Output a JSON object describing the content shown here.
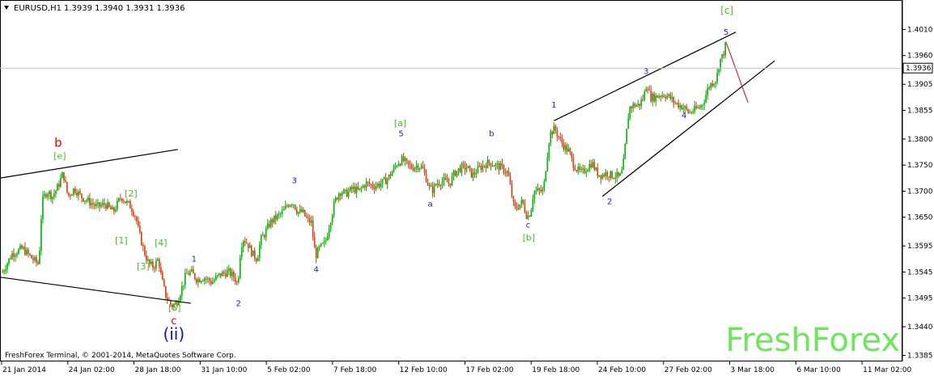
{
  "window": {
    "symbol_label": "EURUSD,H1",
    "ohlc_label": "1.3939 1.3940 1.3931 1.3936",
    "copyright": "FreshForex Terminal, © 2001-2014, MetaQuotes Software Corp.",
    "brand": "FreshForex",
    "menu_icon": "triangle-down-icon"
  },
  "colors": {
    "bull_candle": "#00b000",
    "bear_candle": "#d04010",
    "green_label": "#40c020",
    "blue_label": "#1a1acc",
    "red_label": "#e00000",
    "navy_label": "#0a1a9a",
    "projection": "#c03050",
    "trendline": "#000000",
    "price_tag_bg": "#ffffff"
  },
  "chart_data": {
    "type": "candlestick",
    "symbol": "EURUSD",
    "timeframe": "H1",
    "y_ticks": [
      "1.4010",
      "1.3960",
      "1.3905",
      "1.3855",
      "1.3800",
      "1.3750",
      "1.3700",
      "1.3650",
      "1.3595",
      "1.3545",
      "1.3495",
      "1.3440",
      "1.3385"
    ],
    "ylim": [
      1.3375,
      1.4065
    ],
    "current_price": "1.3936",
    "current_price_value": 1.3936,
    "x_ticks": [
      "21 Jan 2014",
      "24 Jan 02:00",
      "28 Jan 18:00",
      "31 Jan 10:00",
      "5 Feb 02:00",
      "7 Feb 18:00",
      "12 Feb 10:00",
      "17 Feb 02:00",
      "19 Feb 18:00",
      "24 Feb 10:00",
      "27 Feb 02:00",
      "3 Mar 18:00",
      "6 Mar 10:00",
      "11 Mar 02:00"
    ],
    "x_range": [
      0,
      1115
    ],
    "price_path": [
      [
        3,
        1.3545
      ],
      [
        15,
        1.358
      ],
      [
        28,
        1.359
      ],
      [
        40,
        1.357
      ],
      [
        48,
        1.356
      ],
      [
        52,
        1.368
      ],
      [
        58,
        1.37
      ],
      [
        65,
        1.369
      ],
      [
        72,
        1.371
      ],
      [
        78,
        1.3735
      ],
      [
        84,
        1.369
      ],
      [
        92,
        1.3705
      ],
      [
        100,
        1.369
      ],
      [
        110,
        1.368
      ],
      [
        120,
        1.367
      ],
      [
        130,
        1.3675
      ],
      [
        140,
        1.366
      ],
      [
        150,
        1.369
      ],
      [
        155,
        1.368
      ],
      [
        162,
        1.367
      ],
      [
        168,
        1.365
      ],
      [
        172,
        1.362
      ],
      [
        178,
        1.3585
      ],
      [
        184,
        1.356
      ],
      [
        190,
        1.3555
      ],
      [
        196,
        1.357
      ],
      [
        200,
        1.353
      ],
      [
        205,
        1.35
      ],
      [
        212,
        1.348
      ],
      [
        218,
        1.3485
      ],
      [
        224,
        1.351
      ],
      [
        230,
        1.354
      ],
      [
        236,
        1.3545
      ],
      [
        244,
        1.353
      ],
      [
        252,
        1.3535
      ],
      [
        262,
        1.3525
      ],
      [
        272,
        1.354
      ],
      [
        282,
        1.3545
      ],
      [
        290,
        1.3535
      ],
      [
        294,
        1.352
      ],
      [
        297,
        1.358
      ],
      [
        300,
        1.361
      ],
      [
        306,
        1.36
      ],
      [
        312,
        1.358
      ],
      [
        318,
        1.357
      ],
      [
        322,
        1.3605
      ],
      [
        328,
        1.362
      ],
      [
        334,
        1.364
      ],
      [
        342,
        1.365
      ],
      [
        350,
        1.366
      ],
      [
        356,
        1.3675
      ],
      [
        362,
        1.368
      ],
      [
        368,
        1.366
      ],
      [
        374,
        1.366
      ],
      [
        380,
        1.3645
      ],
      [
        385,
        1.364
      ],
      [
        390,
        1.3575
      ],
      [
        395,
        1.359
      ],
      [
        402,
        1.36
      ],
      [
        408,
        1.364
      ],
      [
        414,
        1.368
      ],
      [
        420,
        1.37
      ],
      [
        428,
        1.3695
      ],
      [
        436,
        1.3705
      ],
      [
        444,
        1.37
      ],
      [
        452,
        1.3715
      ],
      [
        462,
        1.371
      ],
      [
        472,
        1.3715
      ],
      [
        480,
        1.3725
      ],
      [
        486,
        1.374
      ],
      [
        492,
        1.3755
      ],
      [
        498,
        1.376
      ],
      [
        504,
        1.375
      ],
      [
        510,
        1.3745
      ],
      [
        516,
        1.375
      ],
      [
        522,
        1.3745
      ],
      [
        526,
        1.373
      ],
      [
        530,
        1.371
      ],
      [
        534,
        1.37
      ],
      [
        540,
        1.3715
      ],
      [
        548,
        1.372
      ],
      [
        556,
        1.3715
      ],
      [
        562,
        1.3735
      ],
      [
        570,
        1.3745
      ],
      [
        578,
        1.3745
      ],
      [
        584,
        1.373
      ],
      [
        590,
        1.374
      ],
      [
        598,
        1.375
      ],
      [
        606,
        1.3755
      ],
      [
        612,
        1.375
      ],
      [
        620,
        1.3745
      ],
      [
        628,
        1.3735
      ],
      [
        632,
        1.37
      ],
      [
        636,
        1.3665
      ],
      [
        640,
        1.367
      ],
      [
        646,
        1.368
      ],
      [
        652,
        1.365
      ],
      [
        656,
        1.366
      ],
      [
        660,
        1.37
      ],
      [
        666,
        1.37
      ],
      [
        672,
        1.37
      ],
      [
        676,
        1.376
      ],
      [
        680,
        1.381
      ],
      [
        686,
        1.382
      ],
      [
        692,
        1.38
      ],
      [
        698,
        1.3785
      ],
      [
        704,
        1.3775
      ],
      [
        708,
        1.3755
      ],
      [
        714,
        1.374
      ],
      [
        720,
        1.3735
      ],
      [
        726,
        1.3745
      ],
      [
        732,
        1.3755
      ],
      [
        738,
        1.3735
      ],
      [
        744,
        1.373
      ],
      [
        750,
        1.3735
      ],
      [
        756,
        1.373
      ],
      [
        762,
        1.373
      ],
      [
        766,
        1.3725
      ],
      [
        770,
        1.374
      ],
      [
        774,
        1.38
      ],
      [
        778,
        1.386
      ],
      [
        784,
        1.3865
      ],
      [
        790,
        1.3865
      ],
      [
        796,
        1.388
      ],
      [
        800,
        1.391
      ],
      [
        804,
        1.388
      ],
      [
        810,
        1.388
      ],
      [
        816,
        1.3885
      ],
      [
        822,
        1.3885
      ],
      [
        828,
        1.388
      ],
      [
        834,
        1.387
      ],
      [
        840,
        1.3865
      ],
      [
        846,
        1.386
      ],
      [
        852,
        1.385
      ],
      [
        858,
        1.3855
      ],
      [
        864,
        1.386
      ],
      [
        868,
        1.3865
      ],
      [
        872,
        1.388
      ],
      [
        876,
        1.39
      ],
      [
        882,
        1.391
      ],
      [
        886,
        1.3915
      ],
      [
        890,
        1.395
      ],
      [
        894,
        1.396
      ],
      [
        898,
        1.3985
      ]
    ],
    "trendlines": [
      {
        "x1": 0,
        "y1": 1.3725,
        "x2": 220,
        "y2": 1.378,
        "color": "#000000"
      },
      {
        "x1": 0,
        "y1": 1.3535,
        "x2": 236,
        "y2": 1.3485,
        "color": "#000000"
      },
      {
        "x1": 685,
        "y1": 1.3835,
        "x2": 910,
        "y2": 1.4005,
        "color": "#000000"
      },
      {
        "x1": 745,
        "y1": 1.369,
        "x2": 958,
        "y2": 1.395,
        "color": "#000000"
      },
      {
        "x1": 898,
        "y1": 1.3985,
        "x2": 925,
        "y2": 1.387,
        "color": "#c03050"
      }
    ],
    "annotations": [
      {
        "text": "b",
        "x": 72,
        "y": 1.3785,
        "color": "red",
        "size": 15
      },
      {
        "text": "[e]",
        "x": 74,
        "y": 1.3762,
        "color": "green",
        "size": 11
      },
      {
        "text": "[2]",
        "x": 162,
        "y": 1.369,
        "color": "green",
        "size": 11
      },
      {
        "text": "[1]",
        "x": 150,
        "y": 1.36,
        "color": "green",
        "size": 11
      },
      {
        "text": "[4]",
        "x": 199,
        "y": 1.3595,
        "color": "green",
        "size": 11
      },
      {
        "text": "[3]",
        "x": 177,
        "y": 1.355,
        "color": "green",
        "size": 11
      },
      {
        "text": "[5]",
        "x": 216,
        "y": 1.347,
        "color": "green",
        "size": 11
      },
      {
        "text": "c",
        "x": 215,
        "y": 1.3445,
        "color": "red",
        "size": 13
      },
      {
        "text": "(ii)",
        "x": 215,
        "y": 1.3415,
        "color": "navy",
        "size": 20
      },
      {
        "text": "1",
        "x": 240,
        "y": 1.3565,
        "color": "blue",
        "size": 10
      },
      {
        "text": "2",
        "x": 295,
        "y": 1.348,
        "color": "blue",
        "size": 10
      },
      {
        "text": "3",
        "x": 364,
        "y": 1.3715,
        "color": "blue",
        "size": 10
      },
      {
        "text": "4",
        "x": 391,
        "y": 1.3545,
        "color": "blue",
        "size": 10
      },
      {
        "text": "[a]",
        "x": 495,
        "y": 1.3825,
        "color": "green",
        "size": 11
      },
      {
        "text": "5",
        "x": 496,
        "y": 1.3805,
        "color": "blue",
        "size": 10
      },
      {
        "text": "a",
        "x": 532,
        "y": 1.367,
        "color": "blue",
        "size": 10
      },
      {
        "text": "b",
        "x": 608,
        "y": 1.3805,
        "color": "blue",
        "size": 10
      },
      {
        "text": "c",
        "x": 653,
        "y": 1.363,
        "color": "blue",
        "size": 10
      },
      {
        "text": "[b]",
        "x": 654,
        "y": 1.3605,
        "color": "green",
        "size": 11
      },
      {
        "text": "1",
        "x": 685,
        "y": 1.386,
        "color": "blue",
        "size": 10
      },
      {
        "text": "2",
        "x": 754,
        "y": 1.3675,
        "color": "blue",
        "size": 10
      },
      {
        "text": "3",
        "x": 799,
        "y": 1.3925,
        "color": "blue",
        "size": 10
      },
      {
        "text": "4",
        "x": 846,
        "y": 1.384,
        "color": "blue",
        "size": 10
      },
      {
        "text": "[c]",
        "x": 899,
        "y": 1.404,
        "color": "green",
        "size": 12
      },
      {
        "text": "5",
        "x": 898,
        "y": 1.4,
        "color": "blue",
        "size": 10
      }
    ]
  }
}
